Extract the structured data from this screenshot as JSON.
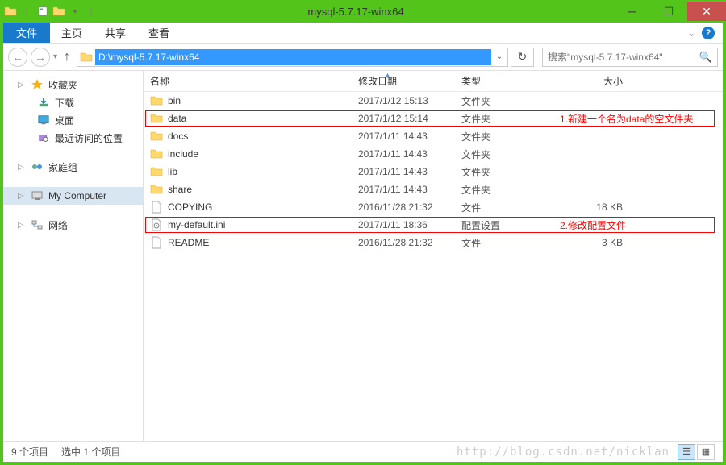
{
  "window": {
    "title": "mysql-5.7.17-winx64"
  },
  "menubar": {
    "file": "文件",
    "home": "主页",
    "share": "共享",
    "view": "查看"
  },
  "navbar": {
    "path": "D:\\mysql-5.7.17-winx64",
    "search_placeholder": "搜索\"mysql-5.7.17-winx64\""
  },
  "sidebar": {
    "favorites": {
      "label": "收藏夹",
      "items": [
        {
          "label": "下载",
          "icon": "download"
        },
        {
          "label": "桌面",
          "icon": "desktop"
        },
        {
          "label": "最近访问的位置",
          "icon": "recent"
        }
      ]
    },
    "homegroup": {
      "label": "家庭组"
    },
    "computer": {
      "label": "My Computer"
    },
    "network": {
      "label": "网络"
    }
  },
  "columns": {
    "name": "名称",
    "date": "修改日期",
    "type": "类型",
    "size": "大小"
  },
  "files": [
    {
      "name": "bin",
      "date": "2017/1/12 15:13",
      "type": "文件夹",
      "size": "",
      "icon": "folder"
    },
    {
      "name": "data",
      "date": "2017/1/12 15:14",
      "type": "文件夹",
      "size": "",
      "icon": "folder"
    },
    {
      "name": "docs",
      "date": "2017/1/11 14:43",
      "type": "文件夹",
      "size": "",
      "icon": "folder"
    },
    {
      "name": "include",
      "date": "2017/1/11 14:43",
      "type": "文件夹",
      "size": "",
      "icon": "folder"
    },
    {
      "name": "lib",
      "date": "2017/1/11 14:43",
      "type": "文件夹",
      "size": "",
      "icon": "folder"
    },
    {
      "name": "share",
      "date": "2017/1/11 14:43",
      "type": "文件夹",
      "size": "",
      "icon": "folder"
    },
    {
      "name": "COPYING",
      "date": "2016/11/28 21:32",
      "type": "文件",
      "size": "18 KB",
      "icon": "file"
    },
    {
      "name": "my-default.ini",
      "date": "2017/1/11 18:36",
      "type": "配置设置",
      "size": "",
      "icon": "ini"
    },
    {
      "name": "README",
      "date": "2016/11/28 21:32",
      "type": "文件",
      "size": "3 KB",
      "icon": "file"
    }
  ],
  "annotations": {
    "a1": "1.新建一个名为data的空文件夹",
    "a2": "2.修改配置文件"
  },
  "statusbar": {
    "count": "9 个项目",
    "selected": "选中 1 个项目",
    "watermark": "http://blog.csdn.net/nicklan"
  }
}
